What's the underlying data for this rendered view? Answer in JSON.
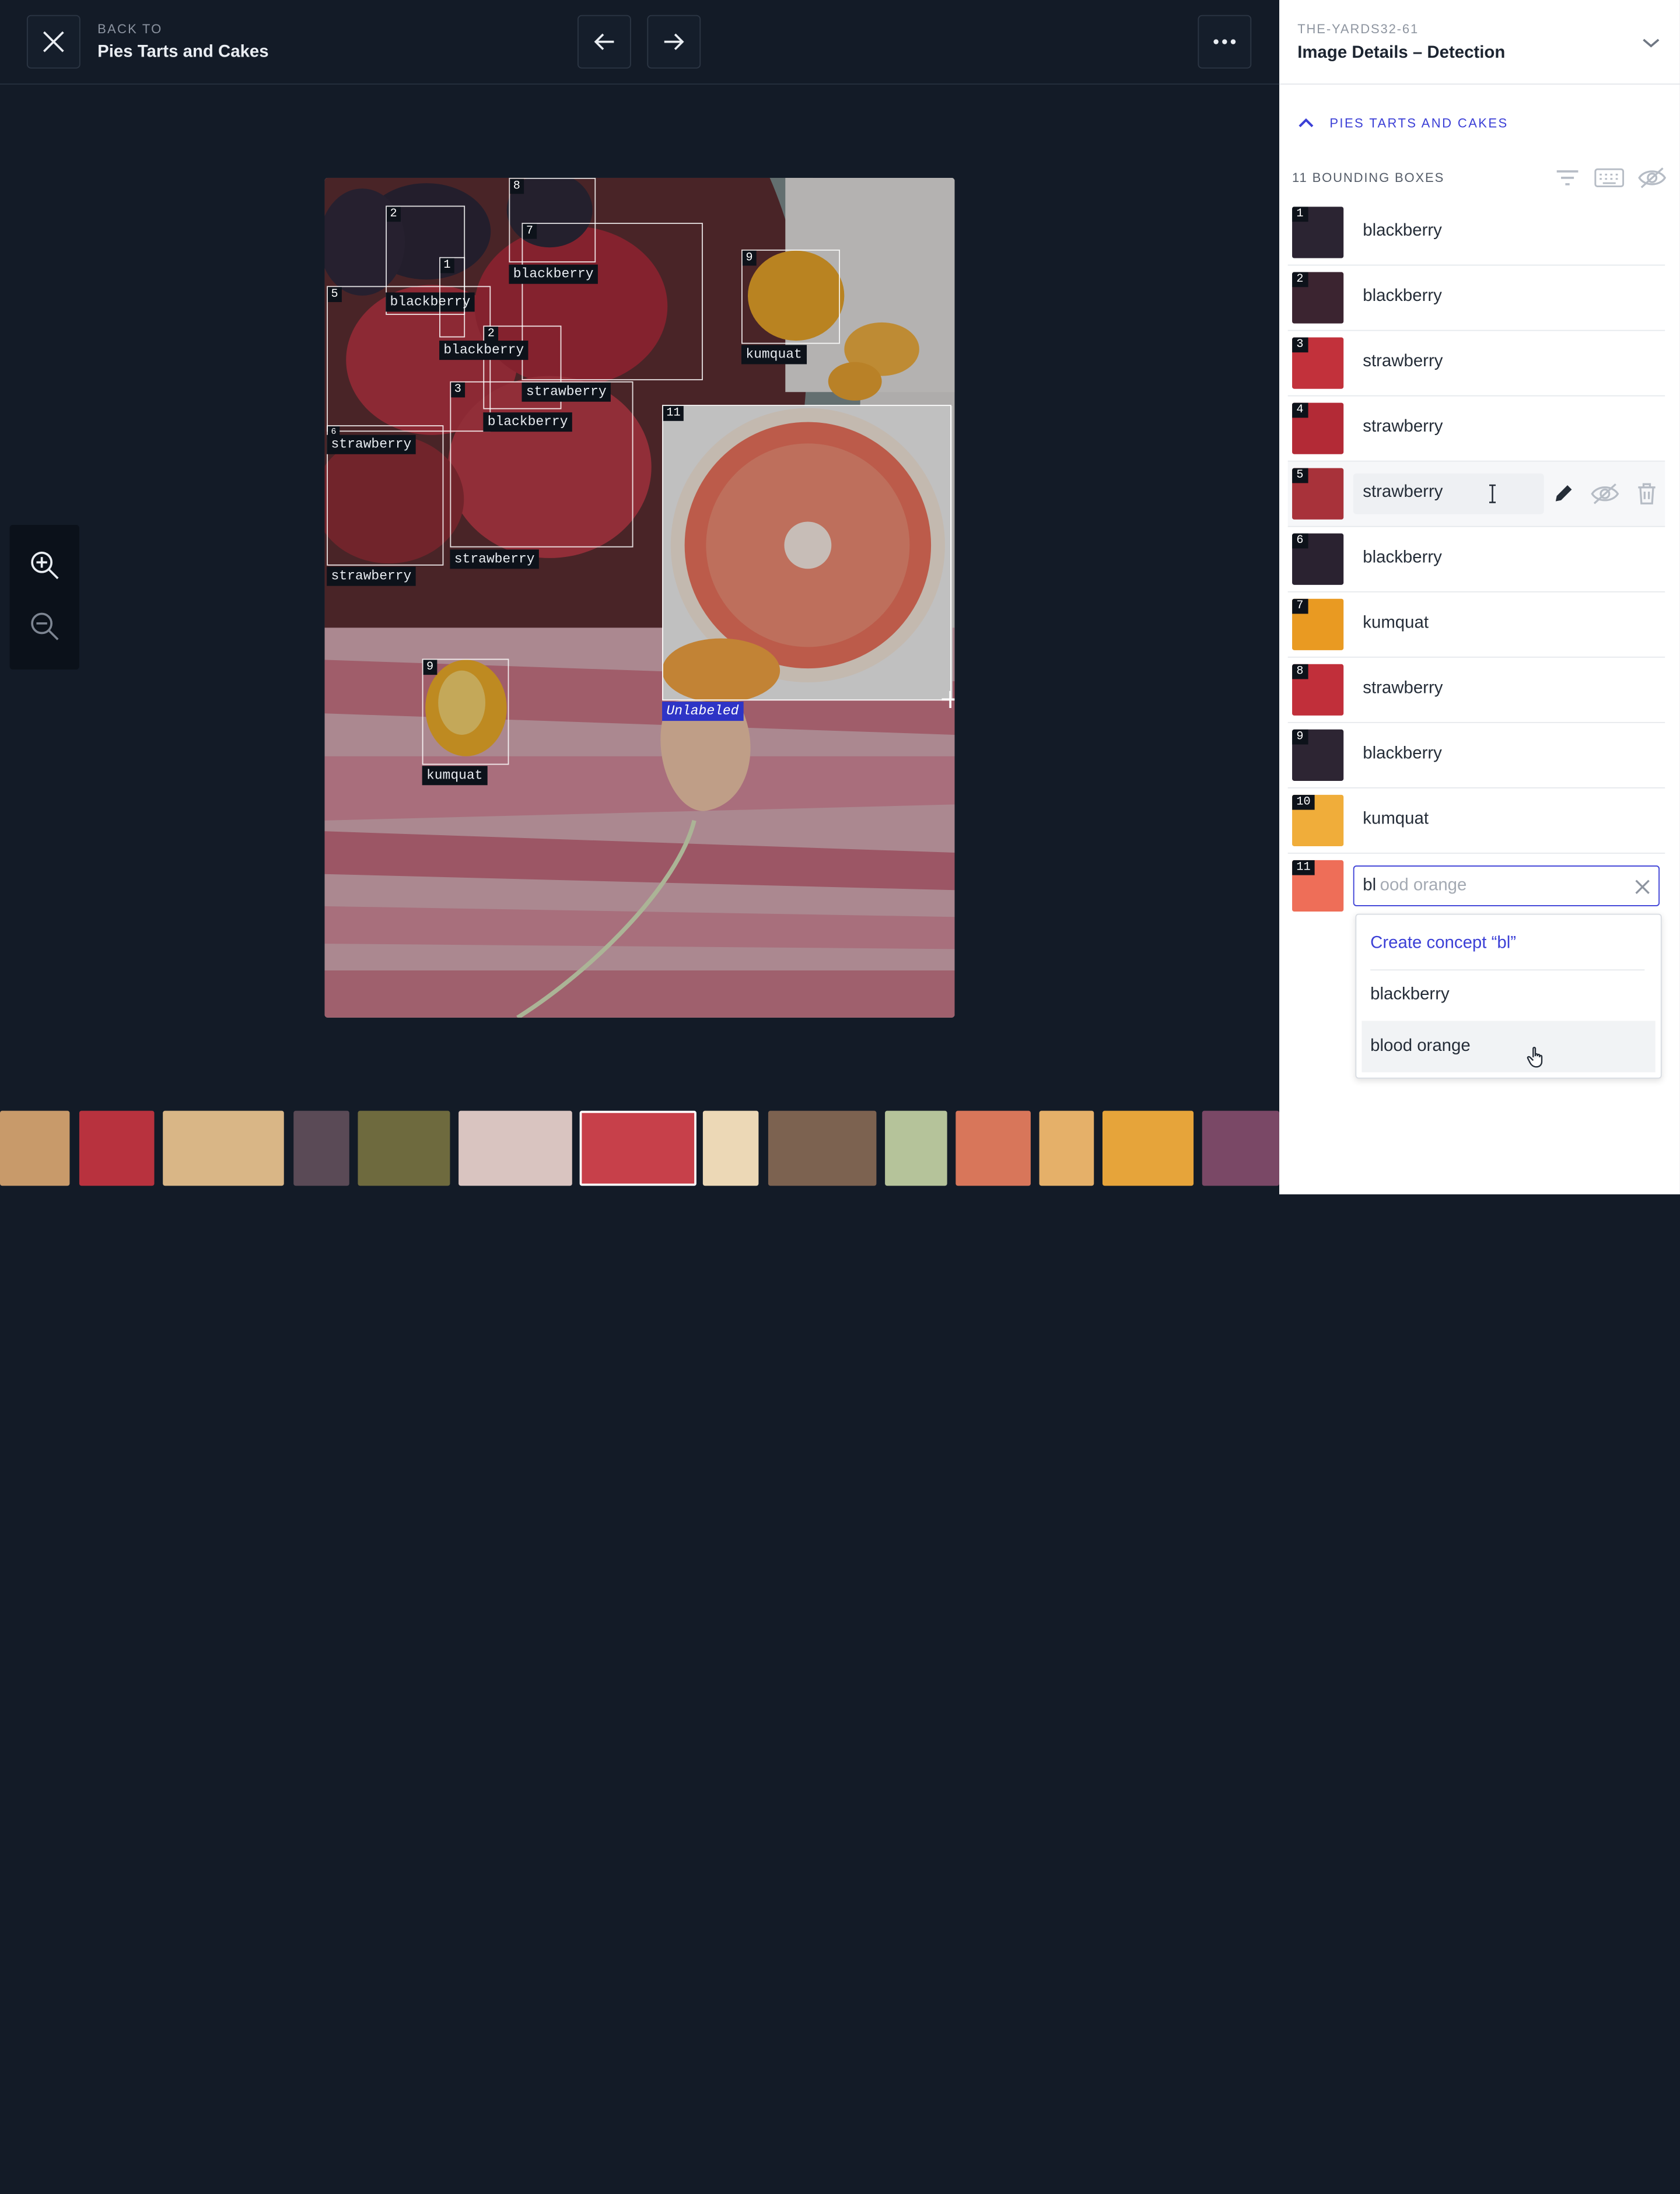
{
  "header": {
    "back_small": "BACK TO",
    "back_title": "Pies Tarts and Cakes"
  },
  "canvas": {
    "boxes": [
      {
        "num": "1",
        "label": "blackberry"
      },
      {
        "num": "2",
        "label": "blackberry"
      },
      {
        "num": "2",
        "label": "blackberry"
      },
      {
        "num": "3",
        "label": "blackberry"
      },
      {
        "num": "5",
        "label": "strawberry"
      },
      {
        "num": "6",
        "label": "strawberry"
      },
      {
        "num": "7",
        "label": "blackberry"
      },
      {
        "num": "8",
        "label": "strawberry"
      },
      {
        "num": "9",
        "label": "kumquat"
      },
      {
        "num": "9",
        "label": "kumquat"
      },
      {
        "num": "11",
        "label": "Unlabeled"
      },
      {
        "num": "",
        "label": "strawberry"
      }
    ]
  },
  "panel": {
    "dataset_id": "THE-YARDS32-61",
    "title": "Image Details – Detection",
    "section": "PIES TARTS AND CAKES",
    "count_label": "11 BOUNDING BOXES",
    "rows": [
      {
        "num": "1",
        "label": "blackberry"
      },
      {
        "num": "2",
        "label": "blackberry"
      },
      {
        "num": "3",
        "label": "strawberry"
      },
      {
        "num": "4",
        "label": "strawberry"
      },
      {
        "num": "5",
        "label": "strawberry"
      },
      {
        "num": "6",
        "label": "blackberry"
      },
      {
        "num": "7",
        "label": "kumquat"
      },
      {
        "num": "8",
        "label": "strawberry"
      },
      {
        "num": "9",
        "label": "blackberry"
      },
      {
        "num": "10",
        "label": "kumquat"
      },
      {
        "num": "11",
        "label": ""
      }
    ],
    "input": {
      "typed": "bl",
      "suggestion_rest": "ood orange"
    },
    "dropdown": {
      "create": "Create concept “bl”",
      "options": [
        "blackberry",
        "blood orange"
      ]
    }
  },
  "colors": {
    "accent": "#3b3fd6",
    "dark_bg": "#131b27",
    "unlabeled_tag": "#2e34c6"
  },
  "icons": [
    "close-icon",
    "arrow-left-icon",
    "arrow-right-icon",
    "more-icon",
    "zoom-in-icon",
    "zoom-out-icon",
    "chevron-down-icon",
    "chevron-up-icon",
    "filter-icon",
    "keyboard-icon",
    "eye-off-icon",
    "pencil-icon",
    "trash-icon",
    "clear-icon",
    "text-cursor-icon",
    "hand-cursor-icon",
    "crosshair-cursor-icon"
  ]
}
